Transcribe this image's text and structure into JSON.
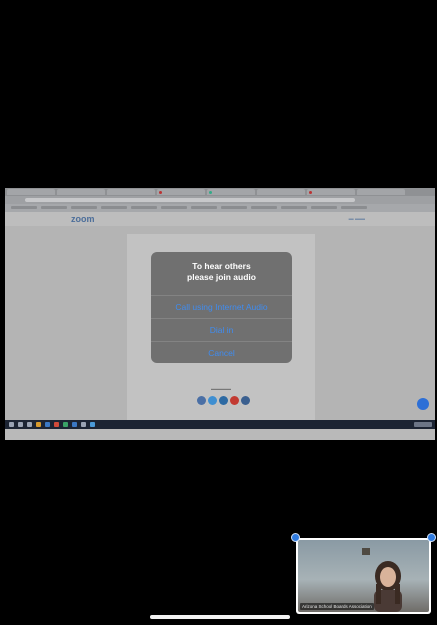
{
  "dialog": {
    "title_line1": "To hear others",
    "title_line2": "please join audio",
    "buttons": {
      "internet_audio": "Call using Internet Audio",
      "dial_in": "Dial in",
      "cancel": "Cancel"
    },
    "accent_color": "#3f8cf0"
  },
  "shared_screen": {
    "zoom_logo": "zoom",
    "icons": {
      "chat_button": "chat-bubble-icon",
      "share_icons": [
        "facebook-icon",
        "twitter-icon",
        "linkedin-icon",
        "youtube-icon",
        "blog-icon"
      ]
    }
  },
  "self_view": {
    "name": "Arizona School Boards Association"
  }
}
